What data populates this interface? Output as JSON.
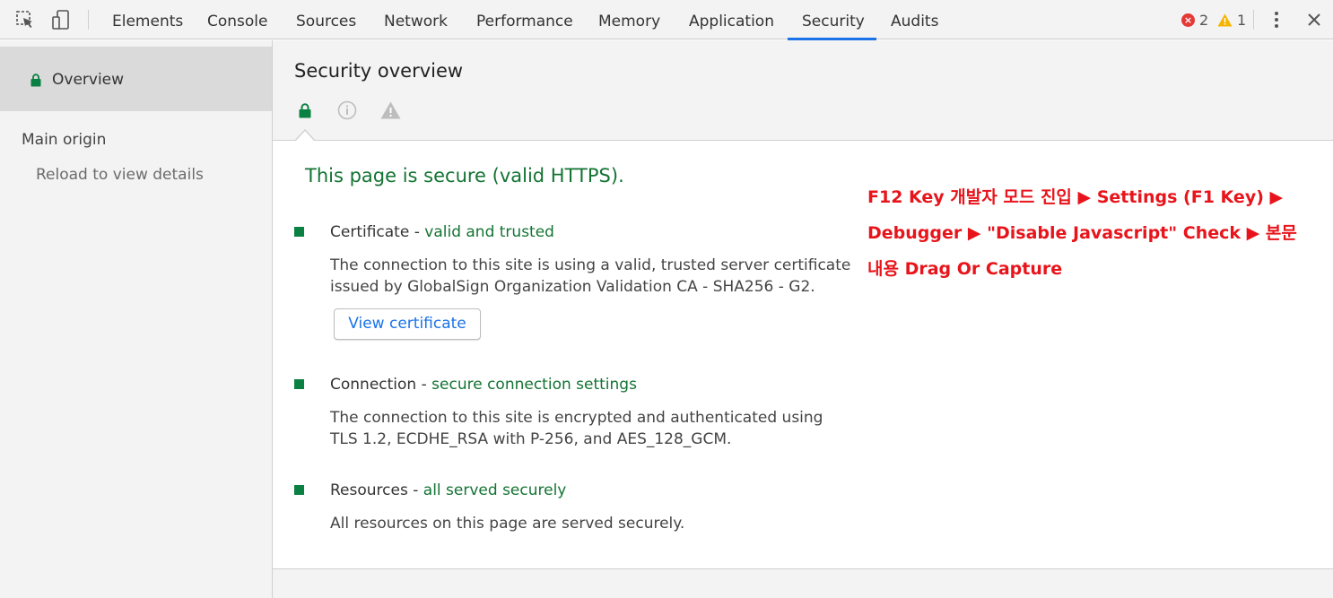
{
  "toolbar": {
    "tabs": [
      {
        "label": "Elements"
      },
      {
        "label": "Console"
      },
      {
        "label": "Sources"
      },
      {
        "label": "Network"
      },
      {
        "label": "Performance"
      },
      {
        "label": "Memory"
      },
      {
        "label": "Application"
      },
      {
        "label": "Security"
      },
      {
        "label": "Audits"
      }
    ],
    "active_tab": "Security",
    "error_count": "2",
    "warning_count": "1",
    "icons": [
      "inspect-icon",
      "device-toggle-icon",
      "error-icon",
      "warning-icon",
      "more-menu-icon",
      "close-icon"
    ]
  },
  "sidebar": {
    "overview_label": "Overview",
    "main_origin_label": "Main origin",
    "reload_text": "Reload to view details"
  },
  "header": {
    "title": "Security overview",
    "filter_icons": [
      "secure-lock-icon",
      "info-icon",
      "warning-icon"
    ]
  },
  "content": {
    "summary": "This page is secure (valid HTTPS).",
    "items": [
      {
        "title": "Certificate",
        "status": "valid and trusted",
        "description": "The connection to this site is using a valid, trusted server certificate issued by GlobalSign Organization Validation CA - SHA256 - G2."
      },
      {
        "title": "Connection",
        "status": "secure connection settings",
        "description": "The connection to this site is encrypted and authenticated using TLS 1.2, ECDHE_RSA with P-256, and AES_128_GCM."
      },
      {
        "title": "Resources",
        "status": "all served securely",
        "description": "All resources on this page are served securely."
      }
    ],
    "view_certificate_label": "View certificate",
    "separator": " - "
  },
  "annotation": {
    "line1": "F12 Key 개발자 모드 진입 ▶ Settings (F1 Key) ▶",
    "line2": "Debugger ▶ \"Disable Javascript\" Check ▶ 본문",
    "line3": "내용 Drag Or Capture"
  },
  "colors": {
    "secure_green": "#137333",
    "bullet_green": "#0b8043",
    "link_blue": "#1a73e8",
    "annotation_red": "#e8141b",
    "panel_gray": "#f3f3f3"
  }
}
